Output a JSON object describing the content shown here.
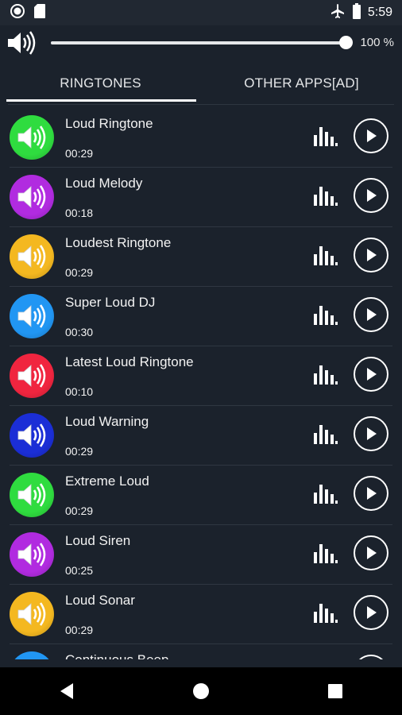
{
  "status": {
    "time": "5:59"
  },
  "volume": {
    "percent_label": "100 %",
    "level": 1.0
  },
  "tabs": [
    {
      "label": "RINGTONES",
      "active": true
    },
    {
      "label": "OTHER APPS[AD]",
      "active": false
    }
  ],
  "ringtones": [
    {
      "title": "Loud Ringtone",
      "duration": "00:29",
      "color": "#2fdc3f"
    },
    {
      "title": "Loud Melody",
      "duration": "00:18",
      "color": "#b12be0"
    },
    {
      "title": "Loudest Ringtone",
      "duration": "00:29",
      "color": "#f4b820"
    },
    {
      "title": "Super Loud DJ",
      "duration": "00:30",
      "color": "#2196f3"
    },
    {
      "title": "Latest Loud Ringtone",
      "duration": "00:10",
      "color": "#f0253f"
    },
    {
      "title": "Loud Warning",
      "duration": "00:29",
      "color": "#1b2ed6"
    },
    {
      "title": "Extreme Loud",
      "duration": "00:29",
      "color": "#2fdc3f"
    },
    {
      "title": "Loud Siren",
      "duration": "00:25",
      "color": "#b12be0"
    },
    {
      "title": "Loud Sonar",
      "duration": "00:29",
      "color": "#f4b820"
    },
    {
      "title": "Continuous Beep",
      "duration": "",
      "color": "#2196f3"
    }
  ],
  "icons": {
    "status_left": [
      "record-icon",
      "sd-card-icon"
    ],
    "status_right": [
      "airplane-mode-icon",
      "battery-icon"
    ],
    "volume": "speaker-icon",
    "row_avatar": "speaker-icon",
    "row_bars": "equalizer-icon",
    "row_play": "play-icon",
    "nav": [
      "back-icon",
      "home-icon",
      "recents-icon"
    ]
  }
}
